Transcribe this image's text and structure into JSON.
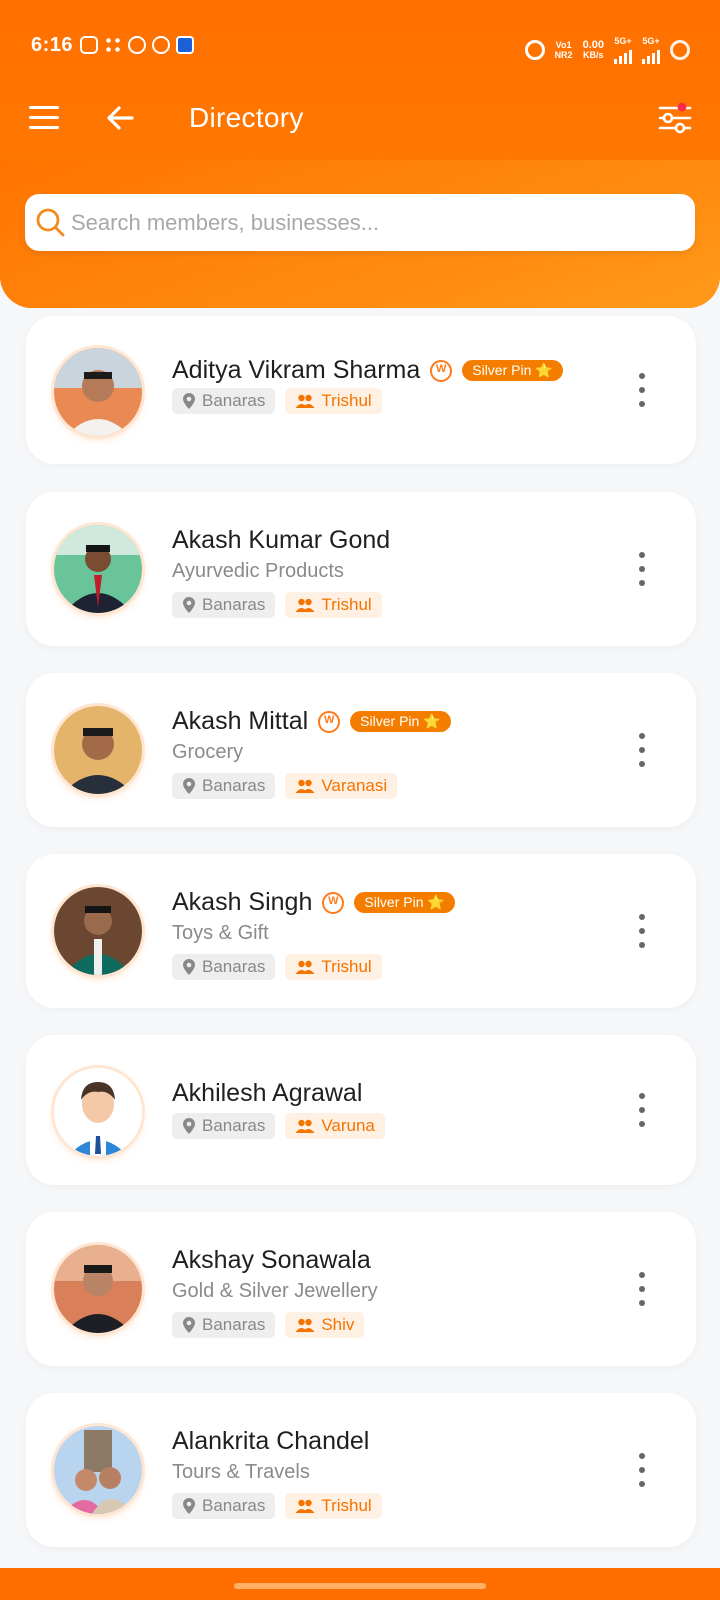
{
  "status_bar": {
    "time": "6:16",
    "volte": "Vo1",
    "nr": "NR2",
    "speed": "0.00",
    "speed_unit": "KB/s",
    "net1": "5G+",
    "net2": "5G+"
  },
  "app_bar": {
    "title": "Directory",
    "menu_icon": "hamburger-menu-icon",
    "back_icon": "arrow-left-icon",
    "filter_icon": "sliders-filter-icon"
  },
  "search": {
    "placeholder": "Search members, businesses..."
  },
  "colors": {
    "primary": "#ff6f00",
    "badge": "#f47d00",
    "group_tag_bg": "#fff0e4",
    "group_tag_text": "#f47400",
    "location_tag_bg": "#eeeeee"
  },
  "members": [
    {
      "name": "Aditya Vikram Sharma",
      "badge": "Silver Pin ⭐",
      "category": "",
      "location": "Banaras",
      "group": "Trishul"
    },
    {
      "name": "Akash Kumar Gond",
      "badge": "",
      "category": "Ayurvedic Products",
      "location": "Banaras",
      "group": "Trishul"
    },
    {
      "name": "Akash Mittal",
      "badge": "Silver Pin ⭐",
      "category": "Grocery",
      "location": "Banaras",
      "group": "Varanasi"
    },
    {
      "name": "Akash Singh",
      "badge": "Silver Pin ⭐",
      "category": "Toys & Gift",
      "location": "Banaras",
      "group": "Trishul"
    },
    {
      "name": "Akhilesh Agrawal",
      "badge": "",
      "category": "",
      "location": "Banaras",
      "group": "Varuna"
    },
    {
      "name": "Akshay Sonawala",
      "badge": "",
      "category": "Gold & Silver Jewellery",
      "location": "Banaras",
      "group": "Shiv"
    },
    {
      "name": "Alankrita Chandel",
      "badge": "",
      "category": "Tours & Travels",
      "location": "Banaras",
      "group": "Trishul"
    }
  ]
}
